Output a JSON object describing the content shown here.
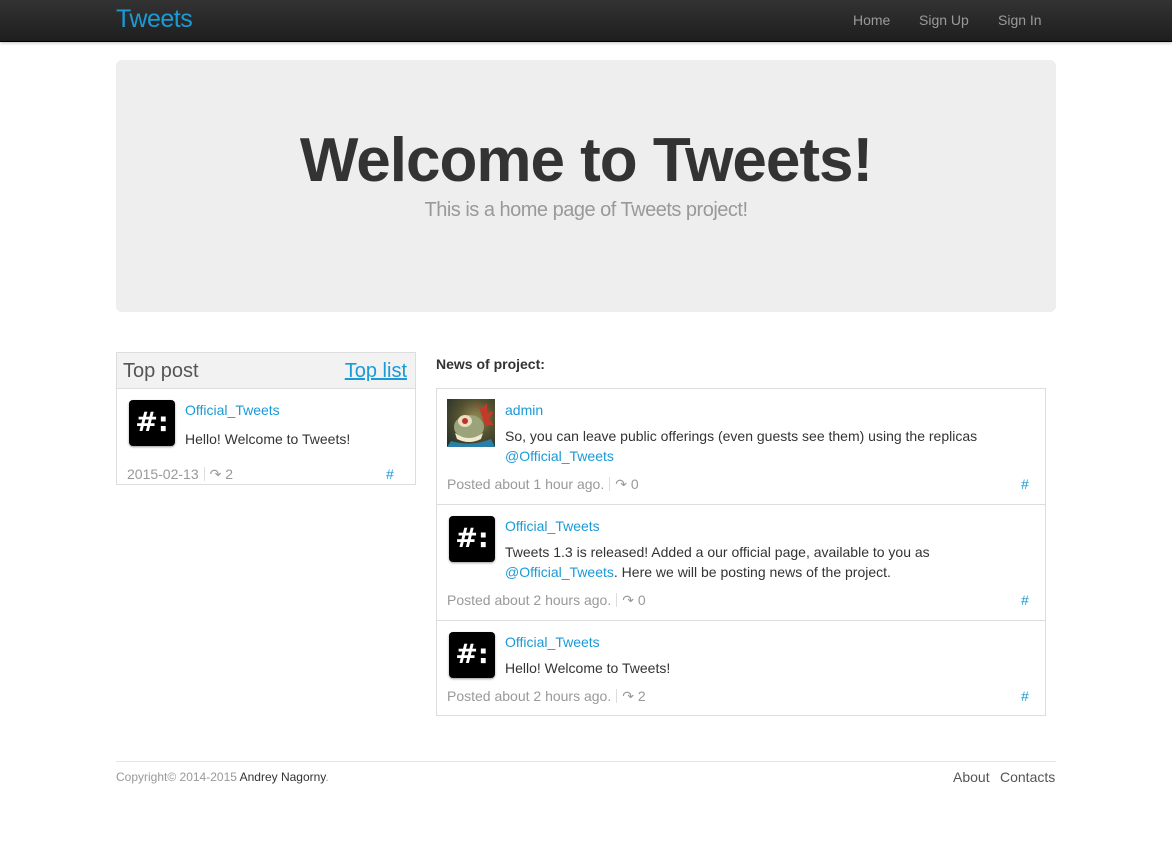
{
  "navbar": {
    "brand": "Tweets",
    "links": [
      "Home",
      "Sign Up",
      "Sign In"
    ]
  },
  "hero": {
    "title": "Welcome to Tweets!",
    "subtitle": "This is a home page of Tweets project!"
  },
  "top_post": {
    "title": "Top post",
    "top_list_link": "Top list",
    "author": "Official_Tweets",
    "avatar_text": "#:",
    "message": "Hello! Welcome to Tweets!",
    "date": "2015-02-13",
    "retweets": "↷ 2",
    "permalink": "#"
  },
  "news": {
    "heading": "News of project:",
    "items": [
      {
        "author": "admin",
        "message_line1": "So, you can leave public offerings (even guests see them) using the replicas",
        "mention": "@Official_Tweets",
        "message_rest": "",
        "posted": "Posted about 1 hour ago.",
        "retweets": "↷ 0",
        "permalink": "#"
      },
      {
        "author": "Official_Tweets",
        "avatar_text": "#:",
        "message_line1": "Tweets 1.3 is released! Added a our official page, available to you as",
        "mention": "@Official_Tweets",
        "message_rest": ". Here we will be posting news of the project.",
        "posted": "Posted about 2 hours ago.",
        "retweets": "↷ 0",
        "permalink": "#"
      },
      {
        "author": "Official_Tweets",
        "avatar_text": "#:",
        "message": "Hello! Welcome to Tweets!",
        "posted": "Posted about 2 hours ago.",
        "retweets": "↷ 2",
        "permalink": "#"
      }
    ]
  },
  "footer": {
    "copyright_prefix": "Copyright© 2014-2015",
    "author": "Andrey Nagorny",
    "period": ".",
    "links": [
      "About",
      "Contacts"
    ]
  },
  "colors": {
    "accent": "#1a9ad6",
    "navbar": "#222222",
    "hero_bg": "#eeeeee"
  }
}
